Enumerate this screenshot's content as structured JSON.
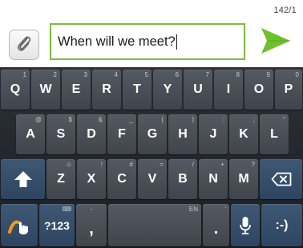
{
  "compose": {
    "char_counter": "142/1",
    "message_value": "When will we meet?",
    "attach_icon": "paperclip-icon",
    "send_icon": "send-arrow-icon",
    "accent_color": "#7dbb3b",
    "send_color": "#6cc12c"
  },
  "keyboard": {
    "row1": [
      {
        "label": "Q",
        "hint": "1"
      },
      {
        "label": "W",
        "hint": "2"
      },
      {
        "label": "E",
        "hint": "3"
      },
      {
        "label": "R",
        "hint": "4"
      },
      {
        "label": "T",
        "hint": "5"
      },
      {
        "label": "Y",
        "hint": "6"
      },
      {
        "label": "U",
        "hint": "7"
      },
      {
        "label": "I",
        "hint": "8"
      },
      {
        "label": "O",
        "hint": "9"
      },
      {
        "label": "P",
        "hint": "0"
      }
    ],
    "row2": [
      {
        "label": "A",
        "hint": "@"
      },
      {
        "label": "S",
        "hint": "$"
      },
      {
        "label": "D",
        "hint": "&"
      },
      {
        "label": "F",
        "hint": "_"
      },
      {
        "label": "G",
        "hint": "("
      },
      {
        "label": "H",
        "hint": ")"
      },
      {
        "label": "J",
        "hint": ":"
      },
      {
        "label": "K",
        "hint": ";"
      },
      {
        "label": "L",
        "hint": "\""
      }
    ],
    "row3": [
      {
        "label": "Z",
        "hint": "☺"
      },
      {
        "label": "X",
        "hint": "!"
      },
      {
        "label": "C",
        "hint": "#"
      },
      {
        "label": "V",
        "hint": "="
      },
      {
        "label": "B",
        "hint": "/"
      },
      {
        "label": "N",
        "hint": "+"
      },
      {
        "label": "M",
        "hint": "?"
      }
    ],
    "shift_icon": "shift-arrow-icon",
    "backspace_icon": "backspace-icon",
    "swype_icon": "swype-hand-icon",
    "symbols_label": "?123",
    "comma_label": ",",
    "comma_hint": "-",
    "space_hint": "EN",
    "period_label": ".",
    "period_hint": "'",
    "mic_icon": "microphone-icon",
    "smiley_label": ":-)"
  }
}
